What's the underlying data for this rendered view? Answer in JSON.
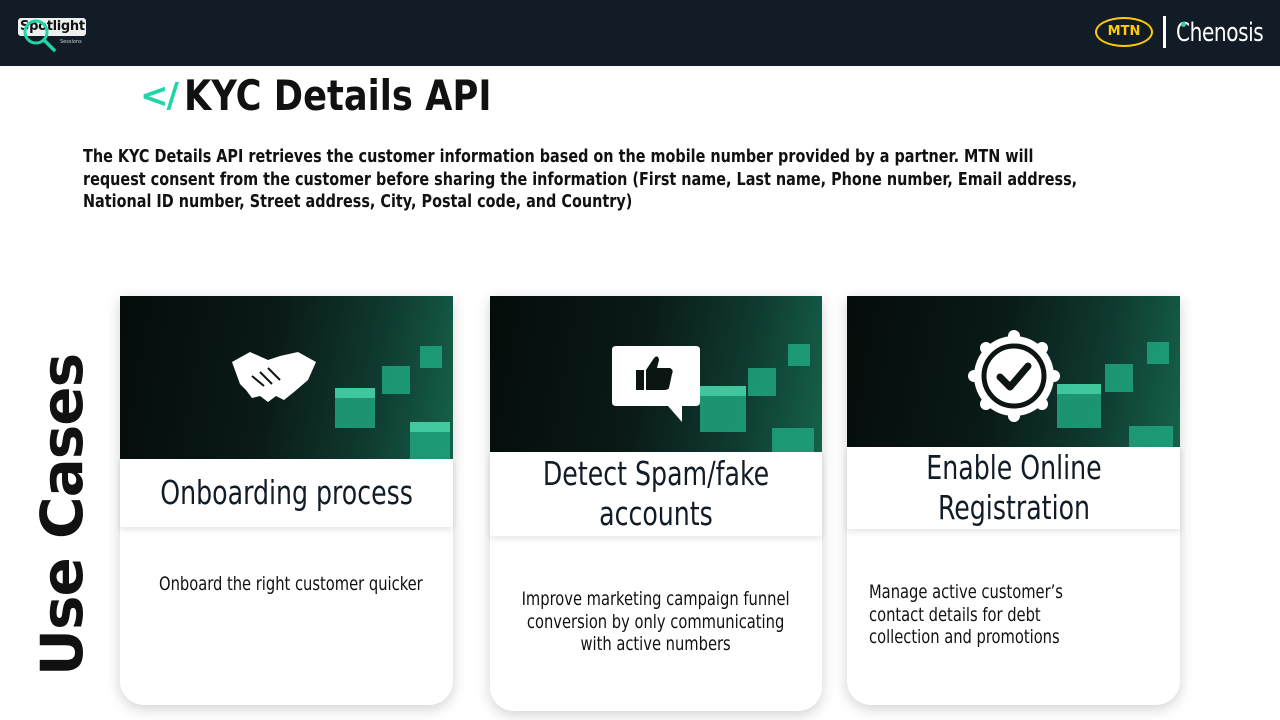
{
  "header": {
    "spotlight_logo_text": "Spotlight",
    "spotlight_logo_subtext": "Sessions",
    "mtn_logo_text": "MTN",
    "partner_logo_text": "Chenosis"
  },
  "page": {
    "title_icon": "code-icon",
    "title": "KYC Details API",
    "description": "The KYC Details API retrieves the customer information based on the mobile number provided by a partner. MTN will request consent from the customer before sharing the information (First name, Last name, Phone number, Email address, National ID number, Street address, City, Postal code, and  Country)",
    "section_label": "Use Cases"
  },
  "cards": [
    {
      "icon": "handshake-icon",
      "heading": "Onboarding process",
      "body": "Onboard the right customer quicker"
    },
    {
      "icon": "thumbs-up-speech-bubble-icon",
      "heading": "Detect Spam/fake accounts",
      "body": "Improve marketing campaign funnel conversion by only communicating with active numbers"
    },
    {
      "icon": "verified-badge-icon",
      "heading": "Enable Online Registration",
      "body": "Manage active customer’s contact details for debt collection and promotions"
    }
  ],
  "colors": {
    "header_bg": "#121c27",
    "accent_teal": "#1ed6a8",
    "mtn_yellow": "#ffcb05"
  }
}
